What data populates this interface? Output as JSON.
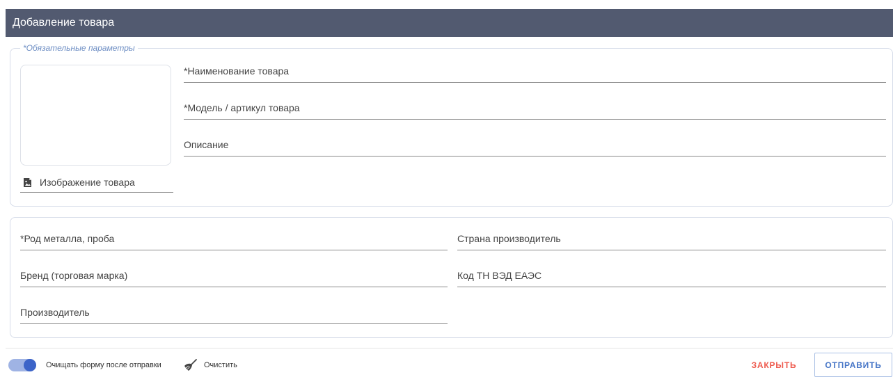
{
  "dialog": {
    "title": "Добавление товара"
  },
  "required_section": {
    "legend": "*Обязательные параметры",
    "image_upload_label": "Изображение товара",
    "fields": {
      "name": {
        "placeholder": "*Наименование товара",
        "value": ""
      },
      "model": {
        "placeholder": "*Модель / артикул товара",
        "value": ""
      },
      "description": {
        "placeholder": "Описание",
        "value": ""
      }
    }
  },
  "details_section": {
    "fields": {
      "metal": {
        "placeholder": "*Род металла, проба",
        "value": ""
      },
      "country": {
        "placeholder": "Страна производитель",
        "value": ""
      },
      "brand": {
        "placeholder": "Бренд (торговая марка)",
        "value": ""
      },
      "tnved": {
        "placeholder": "Код ТН ВЭД ЕАЭС",
        "value": ""
      },
      "manufacturer": {
        "placeholder": "Производитель",
        "value": ""
      }
    }
  },
  "footer": {
    "toggle_label": "Очищать форму после отправки",
    "toggle_on": true,
    "clear_label": "Очистить",
    "close_label": "ЗАКРЫТЬ",
    "send_label": "ОТПРАВИТЬ"
  },
  "colors": {
    "header_bg": "#525a70",
    "accent": "#3c64c8",
    "close": "#ee5b4f",
    "send": "#4776c7"
  },
  "icons": {
    "image_upload": "image-upload-icon",
    "clear": "broom-icon"
  }
}
